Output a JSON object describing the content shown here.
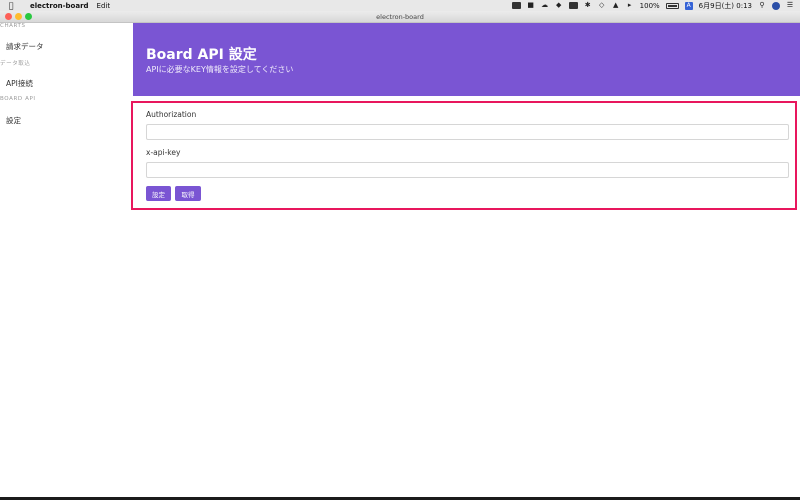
{
  "menubar": {
    "app_name": "electron-board",
    "edit": "Edit",
    "battery_percent": "100%",
    "input_source": "A",
    "datetime": "6月9日(土) 0:13"
  },
  "window": {
    "title": "electron-board"
  },
  "sidebar": {
    "sections": [
      {
        "label": "CHARTS",
        "items": [
          "請求データ"
        ]
      },
      {
        "label": "データ取込",
        "items": [
          "API接続"
        ]
      },
      {
        "label": "BOARD API",
        "items": [
          "設定"
        ]
      }
    ]
  },
  "header": {
    "title": "Board API 設定",
    "subtitle": "APIに必要なKEY情報を設定してください"
  },
  "form": {
    "authorization_label": "Authorization",
    "authorization_value": "",
    "api_key_label": "x-api-key",
    "api_key_value": "",
    "set_button": "設定",
    "get_button": "取得"
  },
  "colors": {
    "accent": "#7a55d3",
    "highlight": "#e8175d"
  }
}
